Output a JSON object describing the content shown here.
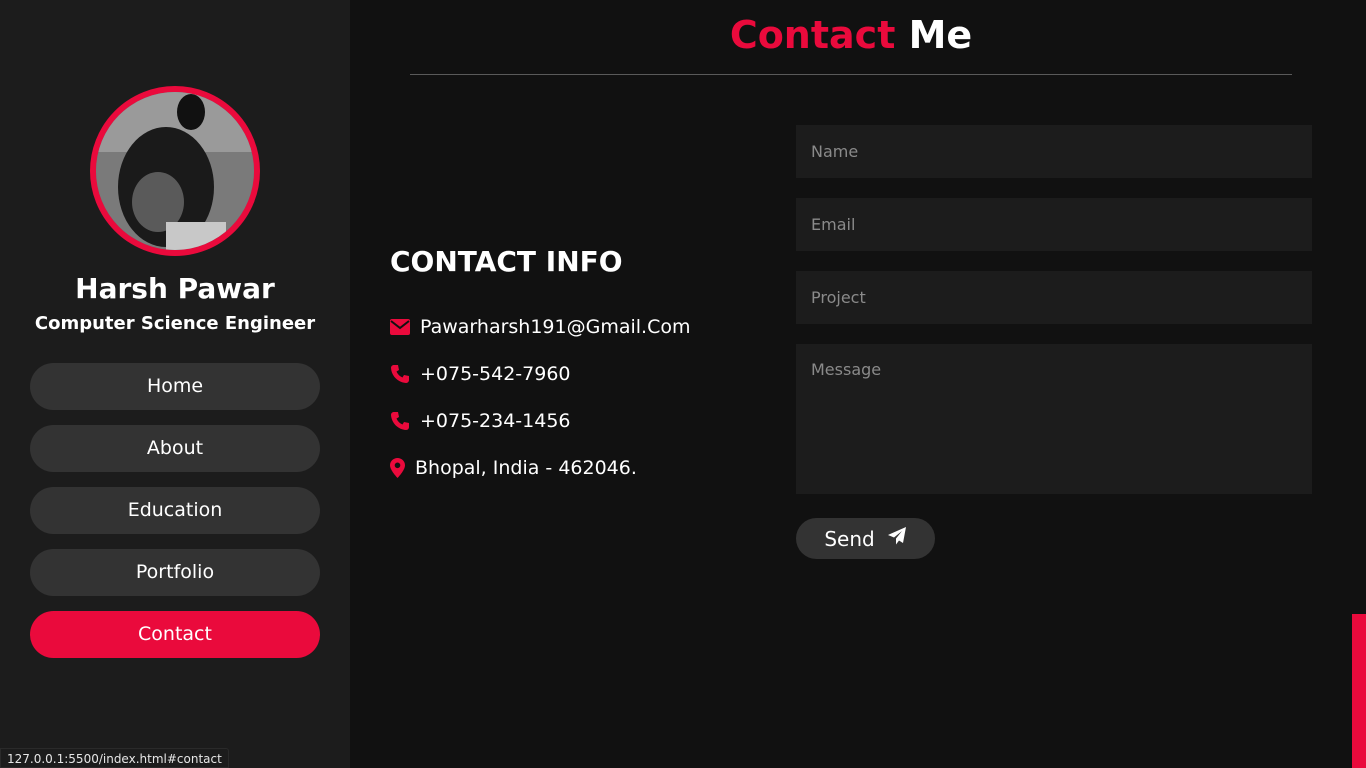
{
  "profile": {
    "name": "Harsh Pawar",
    "role": "Computer Science Engineer"
  },
  "nav": {
    "items": [
      {
        "label": "Home",
        "active": false
      },
      {
        "label": "About",
        "active": false
      },
      {
        "label": "Education",
        "active": false
      },
      {
        "label": "Portfolio",
        "active": false
      },
      {
        "label": "Contact",
        "active": true
      }
    ]
  },
  "section": {
    "title_accent": "Contact",
    "title_rest": "Me"
  },
  "contact_info": {
    "heading": "CONTACT INFO",
    "email": "Pawarharsh191@Gmail.Com",
    "phone1": "+075-542-7960",
    "phone2": "+075-234-1456",
    "address": "Bhopal, India - 462046."
  },
  "form": {
    "name_placeholder": "Name",
    "email_placeholder": "Email",
    "project_placeholder": "Project",
    "message_placeholder": "Message",
    "send_label": "Send"
  },
  "status_bar": {
    "url": "127.0.0.1:5500/index.html#contact"
  },
  "colors": {
    "accent": "#ea0a3c",
    "background": "#111111",
    "sidebar": "#1c1c1c",
    "button": "#333333"
  },
  "icons": {
    "email": "envelope-icon",
    "phone": "phone-icon",
    "address": "map-pin-icon",
    "send": "paper-plane-icon"
  }
}
